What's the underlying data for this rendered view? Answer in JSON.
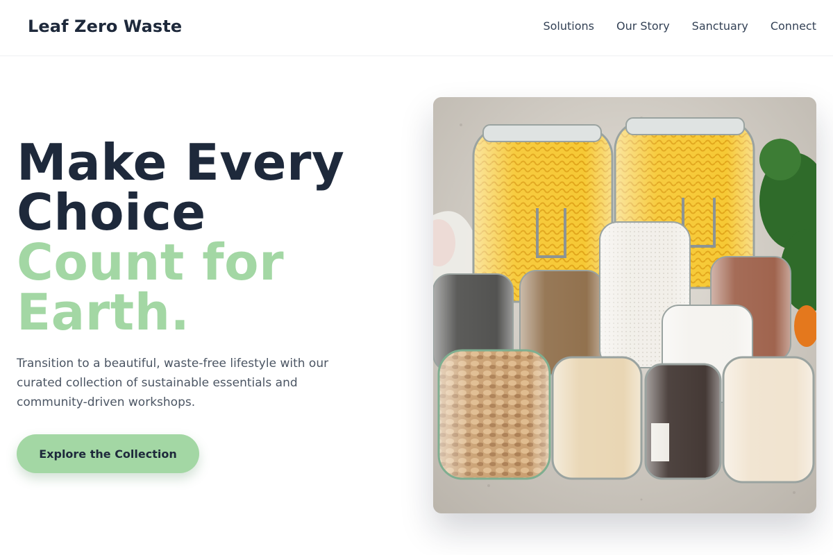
{
  "header": {
    "brand": "Leaf Zero Waste",
    "nav": [
      "Solutions",
      "Our Story",
      "Sanctuary",
      "Connect"
    ]
  },
  "hero": {
    "title_line1": "Make Every",
    "title_line2": "Choice",
    "title_line3": "Count for",
    "title_line4": "Earth.",
    "description": "Transition to a beautiful, waste-free lifestyle with our curated collection of sustainable essentials and community-driven workshops.",
    "cta_label": "Explore the Collection"
  },
  "colors": {
    "brand_dark": "#1e293b",
    "accent_green": "#a3d7a4",
    "body_text": "#4b5563"
  },
  "image": {
    "subject": "glass jars of pasta, nuts, flour, rice, spices on sand"
  }
}
